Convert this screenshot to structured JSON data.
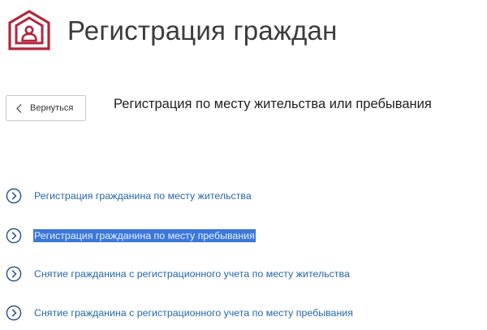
{
  "header": {
    "title": "Регистрация граждан",
    "logo_icon": "house-person-icon",
    "brand_color": "#b1283c"
  },
  "navigation": {
    "back_label": "Вернуться"
  },
  "section": {
    "title": "Регистрация по месту жительства или пребывания"
  },
  "services": [
    {
      "label": "Регистрация гражданина по месту жительства",
      "icon": "chevron-right-circle-icon"
    },
    {
      "label": "Регистрация гражданина по месту пребывания",
      "icon": "chevron-right-circle-icon",
      "selected_text": true
    },
    {
      "label": "Снятие гражданина с регистрационного учета по месту жительства",
      "icon": "chevron-right-circle-icon"
    },
    {
      "label": "Снятие гражданина с регистрационного учета по месту пребывания",
      "icon": "chevron-right-circle-icon"
    }
  ],
  "colors": {
    "link": "#2567a9",
    "icon": "#1e4f8a",
    "selection": "#3b78d8"
  }
}
